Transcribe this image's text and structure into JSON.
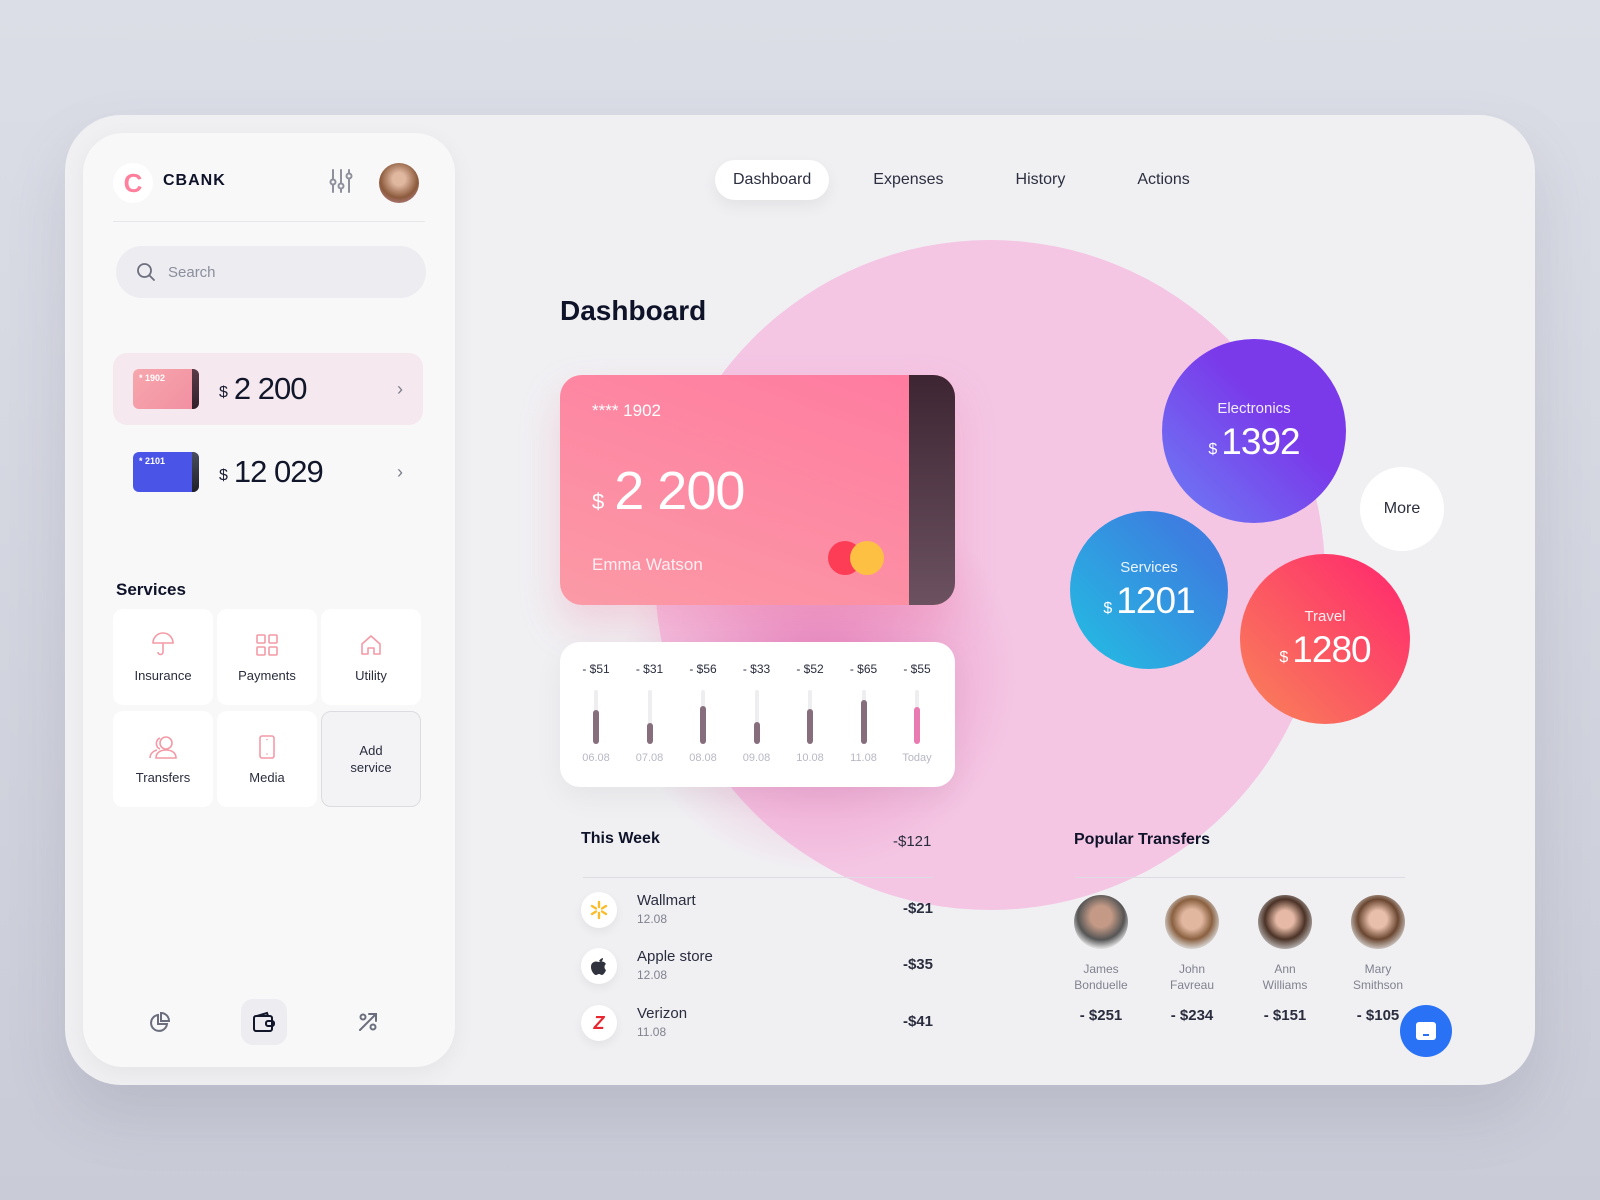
{
  "sidebar": {
    "brand": "CBANK",
    "logo_letter": "C",
    "search_placeholder": "Search",
    "accounts": [
      {
        "card_label": "* 1902",
        "currency": "$",
        "amount": "2 200",
        "active": true
      },
      {
        "card_label": "* 2101",
        "currency": "$",
        "amount": "12 029",
        "active": false
      }
    ],
    "services_title": "Services",
    "services": [
      {
        "label": "Insurance",
        "icon": "umbrella-icon"
      },
      {
        "label": "Payments",
        "icon": "grid-icon"
      },
      {
        "label": "Utility",
        "icon": "home-icon"
      },
      {
        "label": "Transfers",
        "icon": "users-icon"
      },
      {
        "label": "Media",
        "icon": "phone-icon"
      },
      {
        "label": "Add service",
        "icon": null
      }
    ],
    "bottom_nav": [
      {
        "icon": "pie-chart-icon",
        "active": false
      },
      {
        "icon": "wallet-icon",
        "active": true
      },
      {
        "icon": "percent-icon",
        "active": false
      }
    ]
  },
  "tabs": [
    {
      "label": "Dashboard",
      "active": true
    },
    {
      "label": "Expenses",
      "active": false
    },
    {
      "label": "History",
      "active": false
    },
    {
      "label": "Actions",
      "active": false
    }
  ],
  "main": {
    "title": "Dashboard",
    "card": {
      "number": "****  1902",
      "currency": "$",
      "balance": "2 200",
      "holder": "Emma Watson"
    },
    "daily_spending": [
      {
        "amount": "- $51",
        "date": "06.08",
        "value": 51
      },
      {
        "amount": "- $31",
        "date": "07.08",
        "value": 31
      },
      {
        "amount": "- $56",
        "date": "08.08",
        "value": 56
      },
      {
        "amount": "- $33",
        "date": "09.08",
        "value": 33
      },
      {
        "amount": "- $52",
        "date": "10.08",
        "value": 52
      },
      {
        "amount": "- $65",
        "date": "11.08",
        "value": 65
      },
      {
        "amount": "- $55",
        "date": "Today",
        "value": 55
      }
    ],
    "this_week": {
      "title": "This Week",
      "total": "-$121",
      "transactions": [
        {
          "name": "Wallmart",
          "date": "12.08",
          "amount": "-$21",
          "icon": "walmart-icon"
        },
        {
          "name": "Apple store",
          "date": "12.08",
          "amount": "-$35",
          "icon": "apple-icon"
        },
        {
          "name": "Verizon",
          "date": "11.08",
          "amount": "-$41",
          "icon": "verizon-icon"
        }
      ]
    },
    "categories": [
      {
        "label": "Electronics",
        "currency": "$",
        "amount": "1392"
      },
      {
        "label": "Services",
        "currency": "$",
        "amount": "1201"
      },
      {
        "label": "Travel",
        "currency": "$",
        "amount": "1280"
      }
    ],
    "more_label": "More",
    "popular_transfers": {
      "title": "Popular Transfers",
      "people": [
        {
          "first": "James",
          "last": "Bonduelle",
          "amount": "- $251"
        },
        {
          "first": "John",
          "last": "Favreau",
          "amount": "- $234"
        },
        {
          "first": "Ann",
          "last": "Williams",
          "amount": "- $151"
        },
        {
          "first": "Mary",
          "last": "Smithson",
          "amount": "- $105"
        }
      ]
    }
  },
  "colors": {
    "accent_pink": "#ff7aa0",
    "electronics": "#7b3fe8",
    "services": "#2fb8e0",
    "travel": "#ff3d6b",
    "chat": "#2a72f5"
  }
}
